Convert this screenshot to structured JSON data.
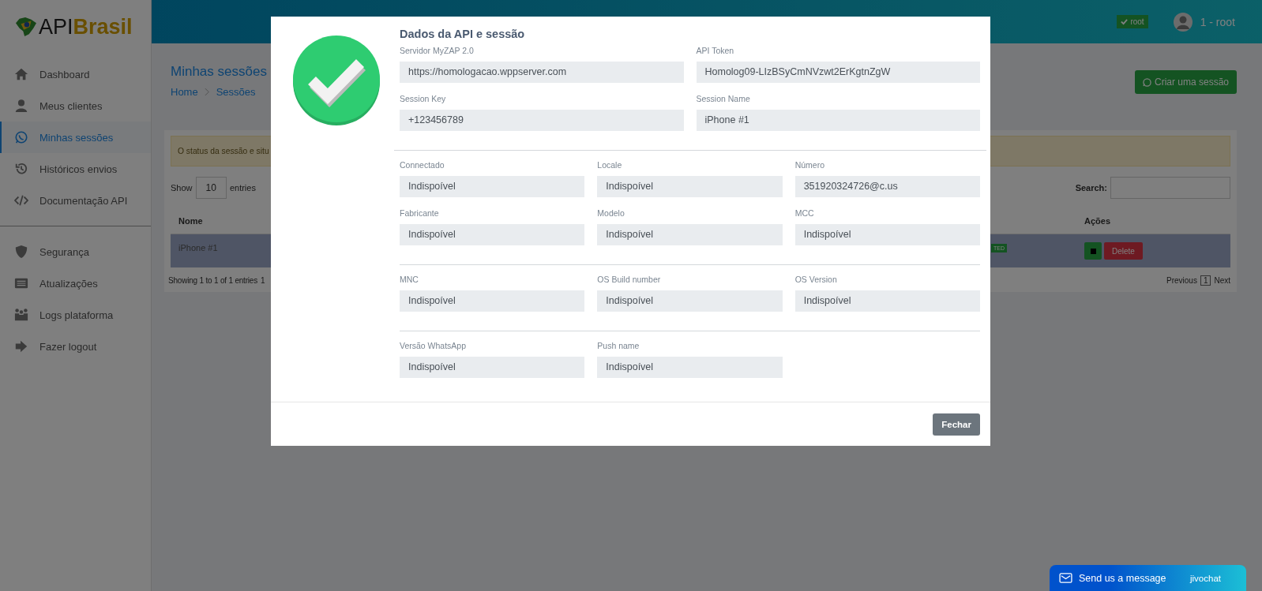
{
  "sidebar": {
    "logo": {
      "part_1": "API",
      "part_2": "Brasil"
    },
    "groups": [
      [
        {
          "label": "Dashboard",
          "selected": false
        },
        {
          "label": "Meus clientes",
          "selected": false
        },
        {
          "label": "Minhas sessões",
          "selected": true
        },
        {
          "label": "Históricos envios",
          "selected": false
        },
        {
          "label": "Documentação API",
          "selected": false
        }
      ],
      [
        {
          "label": "Segurança",
          "selected": false
        },
        {
          "label": "Atualizações",
          "selected": false
        },
        {
          "label": "Logs plataforma",
          "selected": false
        },
        {
          "label": "Fazer logout",
          "selected": false
        }
      ]
    ]
  },
  "header": {
    "badge": "root",
    "user": "1 - root"
  },
  "page": {
    "title": "Minhas sessões",
    "breadcrumb": [
      "Home",
      "Sessões"
    ],
    "create_button": "Criar uma sessão",
    "alert": "O status da sessão e situ",
    "show_label": "Show",
    "entries_value": "10",
    "entries_label": "entries",
    "search_label": "Search:",
    "table": {
      "columns": [
        {
          "label": "Nome"
        },
        {
          "label": "Ações"
        }
      ],
      "rows": [
        {
          "name": "iPhone #1",
          "status": "TED",
          "delete": "Delete",
          "selected": true
        }
      ]
    },
    "info": "Showing 1 to 1 of 1 entries",
    "info_cut": "1",
    "pagination": {
      "previous": "Previous",
      "page": "1",
      "next": "Next"
    }
  },
  "modal": {
    "title": "Dados da API e sessão",
    "sections": [
      {
        "kind": "two_column",
        "rows": [
          [
            {
              "label": "Servidor MyZAP 2.0",
              "value": "https://homologacao.wppserver.com"
            },
            {
              "label": "API Token",
              "value": "Homolog09-LIzBSyCmNVzwt2ErKgtnZgW"
            }
          ],
          [
            {
              "label": "Session Key",
              "value": "+123456789"
            },
            {
              "label": "Session Name",
              "value": "iPhone #1"
            }
          ]
        ]
      },
      {
        "kind": "three_column",
        "rows": [
          [
            {
              "label": "Connectado",
              "value": "Indispoível"
            },
            {
              "label": "Locale",
              "value": "Indispoível"
            },
            {
              "label": "Número",
              "value": "351920324726@c.us"
            }
          ],
          [
            {
              "label": "Fabricante",
              "value": "Indispoível"
            },
            {
              "label": "Modelo",
              "value": "Indispoível"
            },
            {
              "label": "MCC",
              "value": "Indispoível"
            }
          ]
        ]
      },
      {
        "kind": "three_column",
        "rows": [
          [
            {
              "label": "MNC",
              "value": "Indispoível"
            },
            {
              "label": "OS Build number",
              "value": "Indispoível"
            },
            {
              "label": "OS Version",
              "value": "Indispoível"
            }
          ]
        ]
      },
      {
        "kind": "three_column",
        "rows": [
          [
            {
              "label": "Versão WhatsApp",
              "value": "Indispoível"
            },
            {
              "label": "Push name",
              "value": "Indispoível"
            }
          ]
        ]
      }
    ],
    "close_button": "Fechar"
  },
  "chat": {
    "label": "Send us a message",
    "brand": "jivochat"
  }
}
